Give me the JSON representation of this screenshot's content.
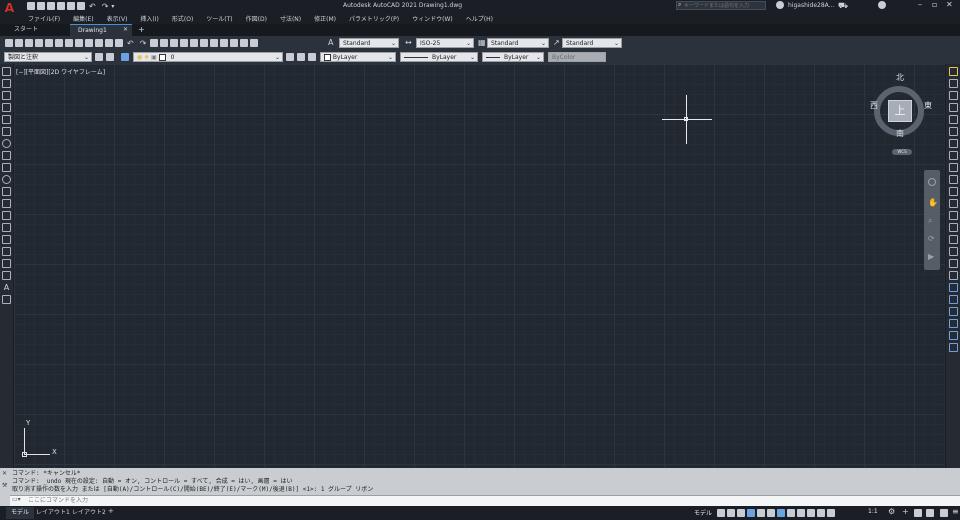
{
  "app": {
    "title": "Autodesk AutoCAD 2021   Drawing1.dwg",
    "logo": "A"
  },
  "search": {
    "placeholder": "キーワードまたは語句を入力"
  },
  "user": {
    "name": "higashide28A..."
  },
  "menu": [
    "ファイル(F)",
    "編集(E)",
    "表示(V)",
    "挿入(I)",
    "形式(O)",
    "ツール(T)",
    "作図(D)",
    "寸法(N)",
    "修正(M)",
    "パラメトリック(P)",
    "ウィンドウ(W)",
    "ヘルプ(H)"
  ],
  "tabs": [
    {
      "label": "スタート",
      "active": false
    },
    {
      "label": "Drawing1",
      "active": true
    }
  ],
  "toolbar1": {
    "textstyle": "Standard",
    "dimstyle": "ISO-25",
    "tablestyle": "Standard",
    "mleaderstyle": "Standard"
  },
  "toolbar2": {
    "workspace": "製図と注釈",
    "layer": "0",
    "color": "ByLayer",
    "linetype": "ByLayer",
    "lineweight": "ByLayer",
    "plotstyle": "ByColor"
  },
  "viewport": {
    "label": "[−][平面図][2D ワイヤフレーム]"
  },
  "viewcube": {
    "north": "北",
    "south": "南",
    "east": "東",
    "west": "西",
    "face": "上",
    "wcs": "WCS"
  },
  "ucs": {
    "x": "X",
    "y": "Y"
  },
  "command": {
    "lines": [
      "コマンド:  *キャンセル*",
      "コマンド:  _undo 現在の設定: 自動 = オン, コントロール = すべて, 合成 = はい, 画層 = はい",
      "取り消す操作の数を入力 または [自動(A)/コントロール(C)/開始(BE)/終了(E)/マーク(M)/後退(B)] <1>: 1 グループ リボン"
    ],
    "placeholder": "ここにコマンドを入力"
  },
  "layout_tabs": [
    "モデル",
    "レイアウト1",
    "レイアウト2"
  ],
  "status": {
    "model": "モデル",
    "scale": "1:1"
  },
  "colors": {
    "canvas": "#212830",
    "accent": "#c0392b"
  },
  "icons": [
    "search-icon",
    "user-icon",
    "cart-icon",
    "help-icon",
    "minimize-icon",
    "restore-icon",
    "close-icon",
    "save-icon",
    "undo-icon",
    "redo-icon",
    "zoom-icon",
    "settings-icon"
  ]
}
